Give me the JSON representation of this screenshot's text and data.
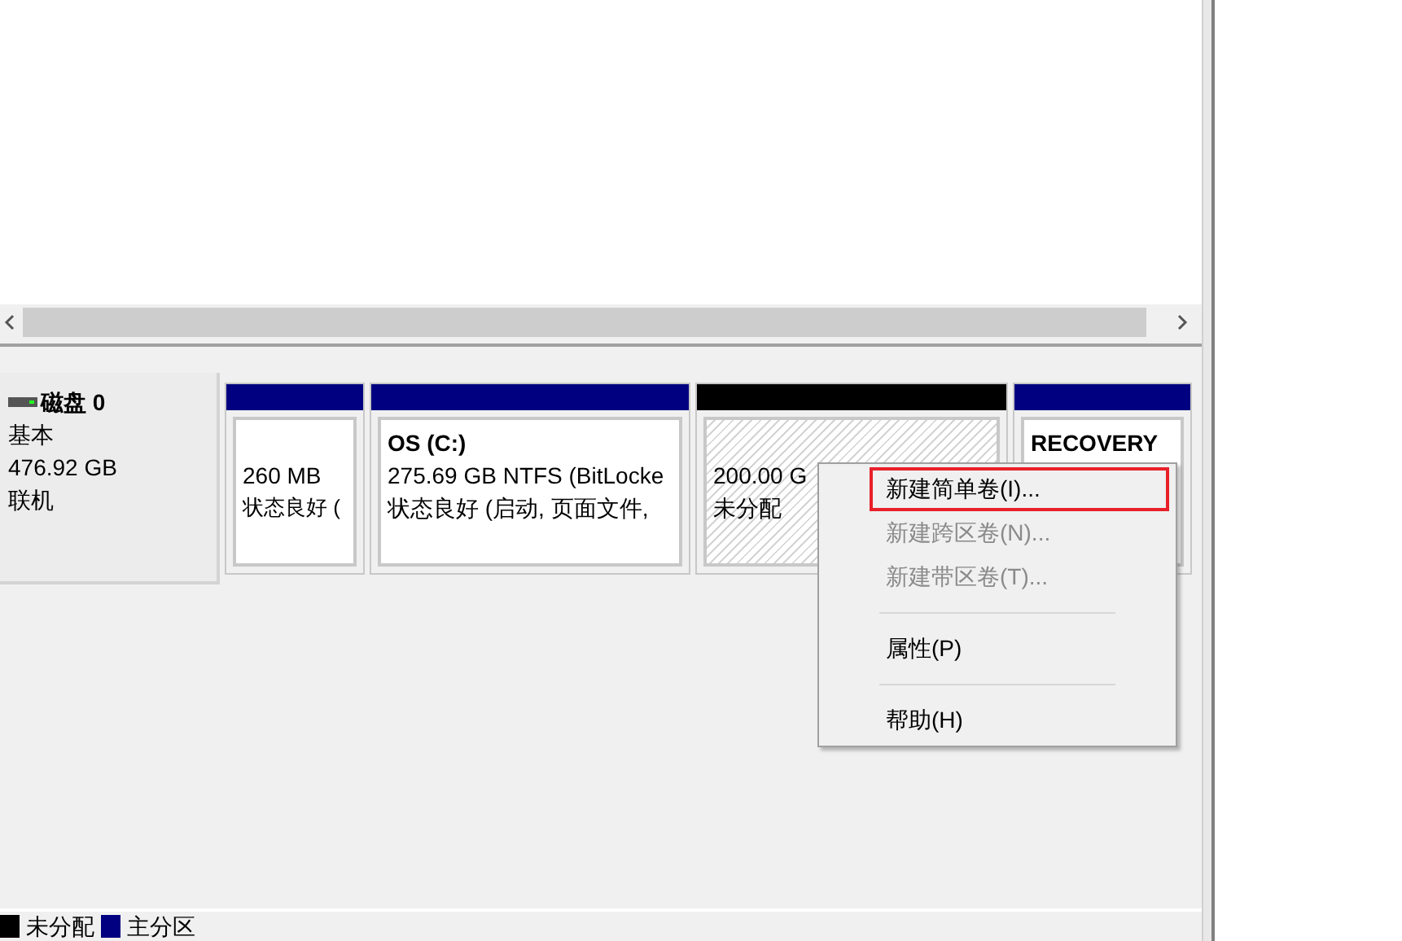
{
  "disk": {
    "name": "磁盘 0",
    "type": "基本",
    "size": "476.92 GB",
    "status": "联机"
  },
  "partitions": [
    {
      "kind": "primary",
      "line_1": "260 MB",
      "line_2": "状态良好 ("
    },
    {
      "kind": "primary",
      "title": "OS  (C:)",
      "line_1": "275.69 GB NTFS (BitLocke",
      "line_2": "状态良好 (启动, 页面文件,"
    },
    {
      "kind": "unallocated",
      "line_1": "200.00 G",
      "line_2": "未分配"
    },
    {
      "kind": "primary",
      "title": "RECOVERY"
    }
  ],
  "context_menu": [
    {
      "kind": "item",
      "label": "新建简单卷(I)...",
      "disabled": false,
      "highlighted": true
    },
    {
      "kind": "item",
      "label": "新建跨区卷(N)...",
      "disabled": true,
      "highlighted": false
    },
    {
      "kind": "item",
      "label": "新建带区卷(T)...",
      "disabled": true,
      "highlighted": false
    },
    {
      "kind": "separator"
    },
    {
      "kind": "item",
      "label": "属性(P)",
      "disabled": false,
      "highlighted": false
    },
    {
      "kind": "separator"
    },
    {
      "kind": "item",
      "label": "帮助(H)",
      "disabled": false,
      "highlighted": false
    }
  ],
  "legend": [
    {
      "label": "未分配",
      "color": "#000000"
    },
    {
      "label": "主分区",
      "color": "#000080"
    }
  ]
}
